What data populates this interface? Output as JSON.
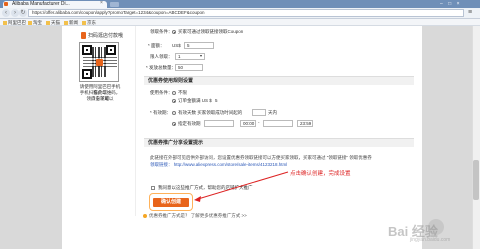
{
  "browser": {
    "tab_title": "Alibaba Manufacturer Di...",
    "url": "https://offer.alibaba.com/coupon/apply?promoTarget=1234&coupon=ABCDEF&coupon",
    "bookmarks": [
      "阿里巴巴",
      "淘宝",
      "天猫",
      "新闻",
      "京东"
    ]
  },
  "sidebar": {
    "caption_top": "扫码逛店付款哦",
    "text_lines": [
      "请使用阿里巴巴手机客户端",
      "手机扫描此二维码，领口令就可以",
      "点击下载"
    ]
  },
  "form": {
    "rows": [
      {
        "label": "领取条件：",
        "value": "买家可通过领取链接领取Coupon"
      },
      {
        "label": "* 面额：",
        "value": "US$",
        "input": "5"
      },
      {
        "label": "限人领取：",
        "input": "1"
      },
      {
        "label": "* 发放总数量：",
        "input": "50"
      }
    ],
    "section1_title": "优惠券使用规则设置",
    "usage_label": "使用条件：",
    "usage_options": [
      "不限",
      "订单金额满 US $"
    ],
    "usage_amount": "5",
    "time_label": "* 有效期：",
    "time_options": [
      "有效天数 买家领取成功时间起的",
      "指定有效期"
    ],
    "days_suffix": "天内",
    "date_from": "",
    "time_from": "00:00",
    "date_to": "",
    "time_to": "23:59",
    "section2_title": "优惠券推广分享设置提示",
    "desc_lines": [
      "此链接在外部可见后供外部访问，您设置优惠券领取链接可以方便买家领取，买家可通过 \"领取链接\" 领取优惠券",
      "领取链接： http://www.aliexpress.com/store/sale-items/4123218.html"
    ],
    "checkbox_label": "我同意以这些推广方式，帮助您的店铺扩大推广",
    "submit_label": "确认创建",
    "annotation": "点击确认创建，完成设置",
    "footer_note": "优惠券推广方式是？ 了解更多优惠券推广方式 >>"
  },
  "watermark": {
    "main": "Bai 经验",
    "sub": "jingyan.baidu.com"
  },
  "colors": {
    "accent": "#e8641b",
    "annotation": "#dd2222",
    "link": "#2a57b7"
  }
}
